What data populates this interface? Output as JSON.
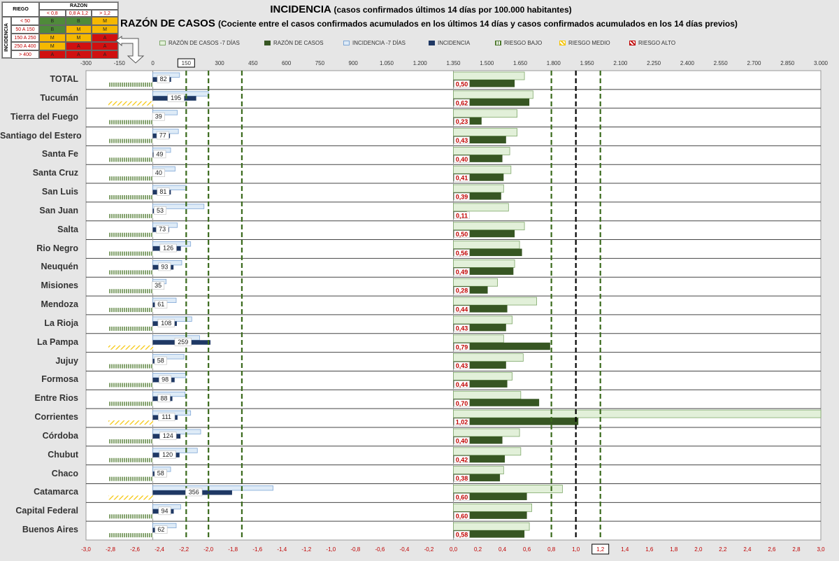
{
  "titles": {
    "line1_main": "INCIDENCIA",
    "line1_sub": "(casos confirmados últimos 14 días por 100.000 habitantes)",
    "line2_main": "RAZÓN DE CASOS",
    "line2_sub": "(Cociente entre el casos confirmados acumulados en los últimos 14 días y casos confirmados acumulados en los 14 días previos)"
  },
  "risk_table": {
    "riesgo_label": "RIEGO",
    "razon_label": "RAZON",
    "incidencia_label": "INCIDENCIA",
    "col_headers": [
      "< 0,8",
      "0,8 A 1,2",
      "> 1,2"
    ],
    "row_headers": [
      "< 50",
      "50 A 150",
      "150 A 250",
      "250 A 400",
      "> 400"
    ],
    "cells": [
      [
        "B",
        "B",
        "M"
      ],
      [
        "B",
        "M",
        "M"
      ],
      [
        "M",
        "M",
        "A"
      ],
      [
        "M",
        "A",
        "A"
      ],
      [
        "A",
        "A",
        "A"
      ]
    ],
    "colors": {
      "B": "#4f8a3a",
      "M": "#f5b800",
      "A": "#d01010"
    }
  },
  "legend": [
    {
      "key": "razon7",
      "label": "RAZÓN DE CASOS -7 DÍAS"
    },
    {
      "key": "razon",
      "label": "RAZÓN DE CASOS"
    },
    {
      "key": "inc7",
      "label": "INCIDENCIA -7 DÍAS"
    },
    {
      "key": "inc",
      "label": "INCIDENCIA"
    },
    {
      "key": "bajo",
      "label": "RIESGO BAJO"
    },
    {
      "key": "medio",
      "label": "RIESGO MEDIO"
    },
    {
      "key": "alto",
      "label": "RIESGO ALTO"
    }
  ],
  "colors": {
    "razon7_fill": "#e2f0d9",
    "razon7_stroke": "#7fa86a",
    "razon_fill": "#375623",
    "inc7_fill": "#deebf7",
    "inc7_stroke": "#7fa7d6",
    "inc_fill": "#1f3864",
    "bajo": "#4f7a2f",
    "medio": "#f5c400",
    "alto": "#c00000",
    "axis_red": "#c00000"
  },
  "chart_data": {
    "type": "bar",
    "orientation": "horizontal",
    "top_axis": {
      "min": -300,
      "max": 3000,
      "ticks": [
        "-300",
        "-150",
        "0",
        "150",
        "300",
        "450",
        "600",
        "750",
        "900",
        "1.050",
        "1.200",
        "1.350",
        "1.500",
        "1.650",
        "1.800",
        "1.950",
        "2.100",
        "2.250",
        "2.400",
        "2.550",
        "2.700",
        "2.850",
        "3.000"
      ],
      "boxed_tick": "150"
    },
    "bottom_axis": {
      "min": -3.0,
      "max": 3.0,
      "ticks": [
        "-3,0",
        "-2,8",
        "-2,6",
        "-2,4",
        "-2,2",
        "-2,0",
        "-1,8",
        "-1,6",
        "-1,4",
        "-1,2",
        "-1,0",
        "-0,8",
        "-0,6",
        "-0,4",
        "-0,2",
        "0,0",
        "0,2",
        "0,4",
        "0,6",
        "0,8",
        "1,0",
        "1,2",
        "1,4",
        "1,6",
        "1,8",
        "2,0",
        "2,2",
        "2,4",
        "2,6",
        "2,8",
        "3,0"
      ],
      "boxed_tick": "1,2"
    },
    "reference_lines": [
      {
        "axis": "top",
        "value": 150,
        "style": "dashed-green"
      },
      {
        "axis": "top",
        "value": 250,
        "style": "dashed-green"
      },
      {
        "axis": "top",
        "value": 400,
        "style": "dashed-green"
      },
      {
        "axis": "bottom",
        "value": 0.8,
        "style": "dashed-green"
      },
      {
        "axis": "bottom",
        "value": 1.0,
        "style": "dashed-black"
      },
      {
        "axis": "bottom",
        "value": 1.2,
        "style": "dashed-green"
      }
    ],
    "categories": [
      "TOTAL",
      "Tucumán",
      "Tierra del Fuego",
      "Santiago del Estero",
      "Santa Fe",
      "Santa Cruz",
      "San Luis",
      "San Juan",
      "Salta",
      "Rio Negro",
      "Neuquén",
      "Misiones",
      "Mendoza",
      "La Rioja",
      "La Pampa",
      "Jujuy",
      "Formosa",
      "Entre Rios",
      "Corrientes",
      "Córdoba",
      "Chubut",
      "Chaco",
      "Catamarca",
      "Capital Federal",
      "Buenos Aires"
    ],
    "incidencia": [
      82,
      195,
      39,
      77,
      49,
      40,
      81,
      53,
      73,
      126,
      93,
      35,
      61,
      108,
      259,
      58,
      98,
      88,
      111,
      124,
      120,
      58,
      356,
      94,
      62
    ],
    "incidencia_labels": [
      "82",
      "195",
      "39",
      "77",
      "49",
      "40",
      "81",
      "53",
      "73",
      "126",
      "93",
      "35",
      "61",
      "108",
      "259",
      "58",
      "98",
      "88",
      "111",
      "124",
      "120",
      "58",
      "356",
      "94",
      "62"
    ],
    "incidencia_7dias": [
      120,
      250,
      110,
      115,
      80,
      100,
      150,
      230,
      110,
      170,
      130,
      60,
      105,
      175,
      210,
      140,
      148,
      145,
      170,
      215,
      200,
      80,
      540,
      125,
      105
    ],
    "razon": [
      0.5,
      0.62,
      0.23,
      0.43,
      0.4,
      0.41,
      0.39,
      0.11,
      0.5,
      0.56,
      0.49,
      0.28,
      0.44,
      0.43,
      0.79,
      0.43,
      0.44,
      0.7,
      1.02,
      0.4,
      0.42,
      0.38,
      0.6,
      0.6,
      0.58
    ],
    "razon_labels": [
      "0,50",
      "0,62",
      "0,23",
      "0,43",
      "0,40",
      "0,41",
      "0,39",
      "0,11",
      "0,50",
      "0,56",
      "0,49",
      "0,28",
      "0,44",
      "0,43",
      "0,79",
      "0,43",
      "0,44",
      "0,70",
      "1,02",
      "0,40",
      "0,42",
      "0,38",
      "0,60",
      "0,60",
      "0,58"
    ],
    "razon_7dias": [
      0.58,
      0.65,
      0.52,
      0.52,
      0.46,
      0.47,
      0.41,
      0.45,
      0.58,
      0.54,
      0.5,
      0.36,
      0.68,
      0.48,
      0.41,
      0.57,
      0.48,
      0.55,
      3.0,
      0.54,
      0.55,
      0.41,
      0.89,
      0.64,
      0.62
    ],
    "riesgo": [
      "bajo",
      "medio",
      "bajo",
      "bajo",
      "bajo",
      "bajo",
      "bajo",
      "bajo",
      "bajo",
      "bajo",
      "bajo",
      "bajo",
      "bajo",
      "bajo",
      "medio",
      "bajo",
      "bajo",
      "bajo",
      "medio",
      "bajo",
      "bajo",
      "bajo",
      "medio",
      "bajo",
      "bajo"
    ]
  }
}
